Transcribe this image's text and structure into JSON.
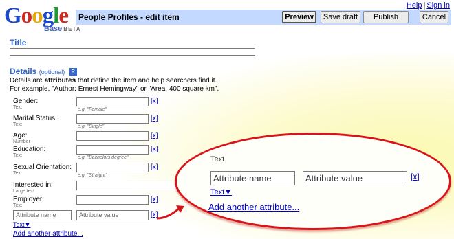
{
  "logo": {
    "word": [
      "G",
      "o",
      "o",
      "g",
      "l",
      "e"
    ],
    "sub": "Base",
    "beta": "BETA"
  },
  "header": {
    "page_title": "People Profiles - edit item",
    "buttons": {
      "preview": "Preview",
      "save_draft": "Save draft",
      "publish": "Publish",
      "cancel": "Cancel"
    },
    "links": {
      "help": "Help",
      "separator": "|",
      "sign_in": "Sign in"
    }
  },
  "title_section": {
    "label": "Title",
    "value": ""
  },
  "details": {
    "heading": "Details",
    "optional": "(optional)",
    "help": "?",
    "desc_line1_pre": "Details are ",
    "desc_line1_bold": "attributes",
    "desc_line1_post": " that define the item and help searchers find it.",
    "desc_line2": "For example, \"Author: Ernest Hemingway\" or \"Area: 400 square km\".",
    "fields": [
      {
        "label": "Gender:",
        "type": "Text",
        "hint": "e.g. \"Female\"",
        "remove": "[x]"
      },
      {
        "label": "Marital Status:",
        "type": "Text",
        "hint": "e.g. \"Single\"",
        "remove": "[x]"
      },
      {
        "label": "Age:",
        "type": "Number",
        "hint": "",
        "remove": "[x]"
      },
      {
        "label": "Education:",
        "type": "Text",
        "hint": "e.g. \"Bachelors degree\"",
        "remove": "[x]"
      },
      {
        "label": "Sexual Orientation:",
        "type": "Text",
        "hint": "e.g. \"Straight\"",
        "remove": "[x]"
      },
      {
        "label": "Interested in:",
        "type": "Large text",
        "hint": "",
        "remove": ""
      },
      {
        "label": "Employer:",
        "type": "Text",
        "hint": "",
        "remove": "[x]"
      }
    ],
    "new_attr": {
      "name_placeholder": "Attribute name",
      "value_placeholder": "Attribute value",
      "remove": "[x]",
      "type": "Text▼"
    },
    "add_link": "Add another attribute..."
  },
  "callout": {
    "type_label": "Text",
    "name_placeholder": "Attribute name",
    "value_placeholder": "Attribute value",
    "remove": "[x]",
    "type_dropdown": "Text▼",
    "add_link": "Add another attribute..."
  },
  "colors": {
    "header_bar": "#c3d9ff",
    "section_heading": "#3366cc",
    "callout_border": "#d8141a",
    "link": "#0000cc"
  }
}
